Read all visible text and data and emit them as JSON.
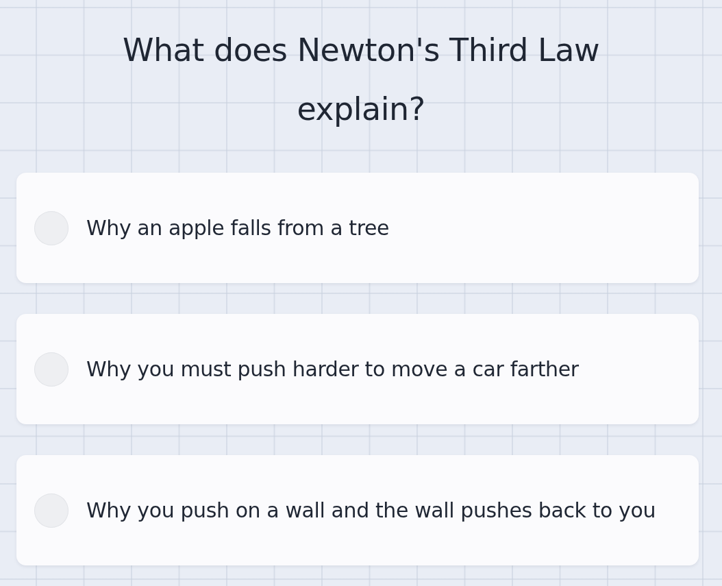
{
  "question": "What does Newton's Third Law explain?",
  "options": [
    {
      "text": "Why an apple falls from a tree",
      "selected": false
    },
    {
      "text": "Why you must push harder to move a car farther",
      "selected": false
    },
    {
      "text": "Why you push on a wall and the wall pushes back to you",
      "selected": false
    }
  ]
}
